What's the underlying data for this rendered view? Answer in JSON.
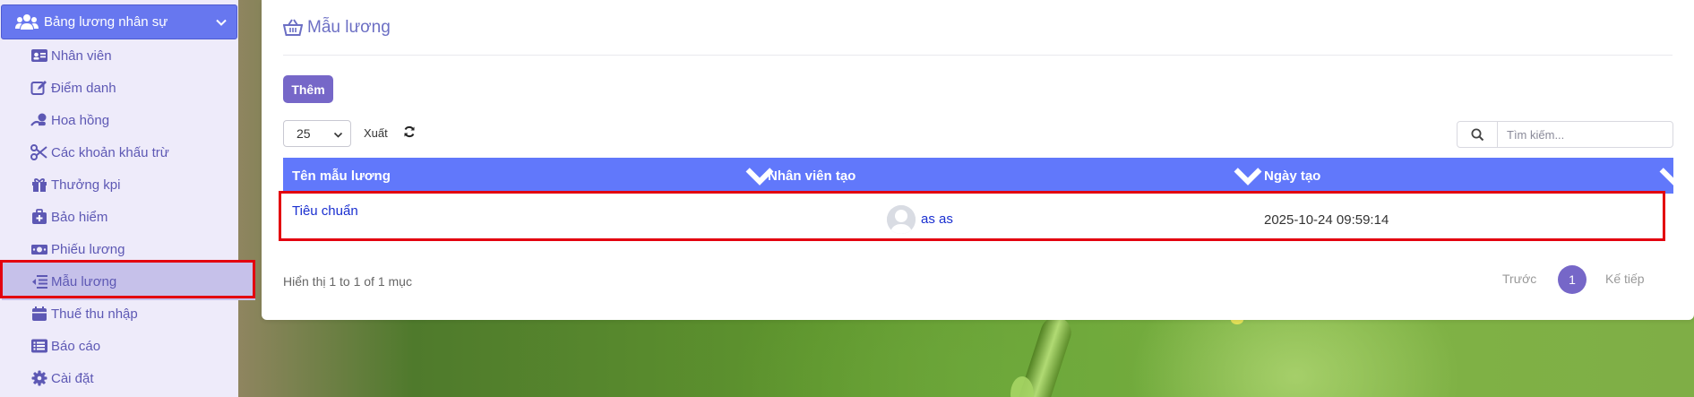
{
  "sidebar": {
    "header_title": "Bảng lương nhân sự",
    "items": [
      {
        "label": "Nhân viên",
        "icon": "id-card-icon"
      },
      {
        "label": "Điểm danh",
        "icon": "edit-icon"
      },
      {
        "label": "Hoa hồng",
        "icon": "hand-money-icon"
      },
      {
        "label": "Các khoản khấu trừ",
        "icon": "scissors-icon"
      },
      {
        "label": "Thưởng kpi",
        "icon": "gift-icon"
      },
      {
        "label": "Bảo hiểm",
        "icon": "medkit-icon"
      },
      {
        "label": "Phiếu lương",
        "icon": "money-bill-icon"
      },
      {
        "label": "Mẫu lương",
        "icon": "indent-icon",
        "active": true
      },
      {
        "label": "Thuế thu nhập",
        "icon": "calendar-icon"
      },
      {
        "label": "Báo cáo",
        "icon": "list-icon"
      },
      {
        "label": "Cài đặt",
        "icon": "gear-icon"
      }
    ]
  },
  "main": {
    "title": "Mẫu lương",
    "add_label": "Thêm",
    "page_length": "25",
    "export_label": "Xuất",
    "search": {
      "placeholder": "Tìm kiếm..."
    },
    "table": {
      "columns": [
        "Tên mẫu lương",
        "Nhân viên tạo",
        "Ngày tạo"
      ],
      "rows": [
        {
          "name": "Tiêu chuẩn",
          "creator": "as as",
          "created": "2025-10-24 09:59:14"
        }
      ]
    },
    "info": "Hiển thị 1 to 1 of 1 mục",
    "pagination": {
      "prev": "Trước",
      "page": "1",
      "next": "Kế tiếp"
    }
  },
  "colors": {
    "accent": "#6777ef",
    "table_header": "#6178fb",
    "button": "#7667c8",
    "highlight": "#e3000f"
  }
}
